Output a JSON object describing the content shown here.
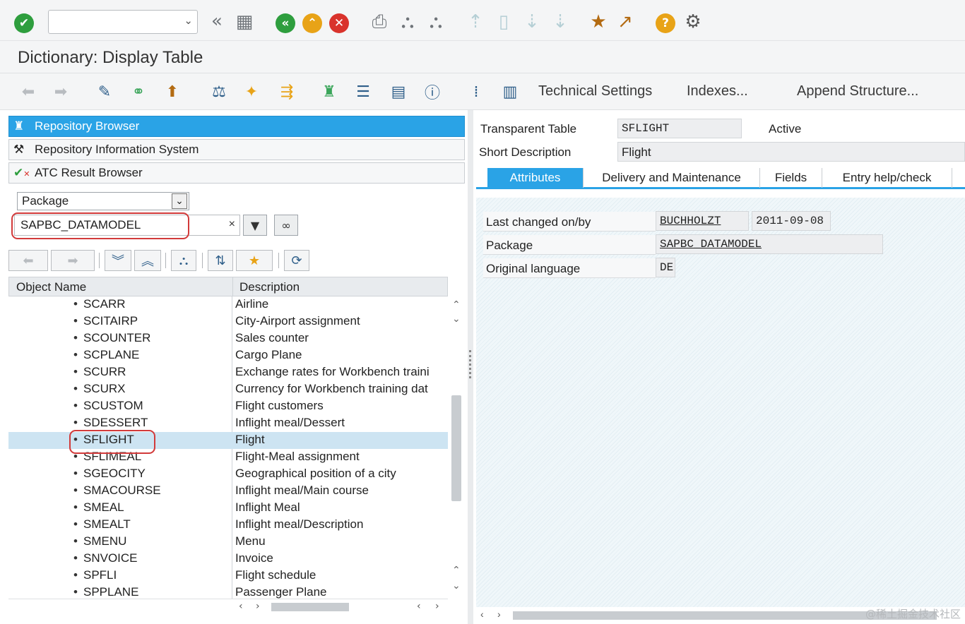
{
  "system_toolbar": {
    "command_field": {
      "value": "",
      "placeholder": ""
    },
    "icons": [
      "enter-check-icon",
      "command-field-dropdown-icon",
      "collapse-left-icon",
      "save-icon",
      "back-icon",
      "exit-icon",
      "cancel-icon",
      "print-icon",
      "find-icon",
      "find-next-icon",
      "first-page-icon",
      "previous-page-icon",
      "next-page-icon",
      "last-page-icon",
      "create-session-icon",
      "shortcut-icon",
      "help-icon",
      "settings-icon"
    ]
  },
  "title": "Dictionary: Display Table",
  "app_toolbar": {
    "technical_settings": "Technical Settings",
    "indexes": "Indexes...",
    "append_structure": "Append Structure..."
  },
  "left_panel": {
    "nav": [
      {
        "label": "Repository Browser",
        "active": true
      },
      {
        "label": "Repository Information System",
        "active": false
      },
      {
        "label": "ATC Result Browser",
        "active": false
      }
    ],
    "object_type": "Package",
    "object_input": "SAPBC_DATAMODEL",
    "tree_header": {
      "name": "Object Name",
      "description": "Description"
    },
    "rows": [
      {
        "name": "SCARR",
        "desc": "Airline"
      },
      {
        "name": "SCITAIRP",
        "desc": "City-Airport assignment"
      },
      {
        "name": "SCOUNTER",
        "desc": "Sales counter"
      },
      {
        "name": "SCPLANE",
        "desc": "Cargo Plane"
      },
      {
        "name": "SCURR",
        "desc": "Exchange rates for Workbench traini"
      },
      {
        "name": "SCURX",
        "desc": "Currency for Workbench training dat"
      },
      {
        "name": "SCUSTOM",
        "desc": "Flight customers"
      },
      {
        "name": "SDESSERT",
        "desc": "Inflight meal/Dessert"
      },
      {
        "name": "SFLIGHT",
        "desc": "Flight",
        "selected": true
      },
      {
        "name": "SFLIMEAL",
        "desc": "Flight-Meal assignment"
      },
      {
        "name": "SGEOCITY",
        "desc": "Geographical position of a city"
      },
      {
        "name": "SMACOURSE",
        "desc": "Inflight meal/Main course"
      },
      {
        "name": "SMEAL",
        "desc": "Inflight Meal"
      },
      {
        "name": "SMEALT",
        "desc": "Inflight meal/Description"
      },
      {
        "name": "SMENU",
        "desc": "Menu"
      },
      {
        "name": "SNVOICE",
        "desc": "Invoice"
      },
      {
        "name": "SPFLI",
        "desc": "Flight schedule"
      },
      {
        "name": "SPPLANE",
        "desc": "Passenger Plane"
      }
    ]
  },
  "right_panel": {
    "table_type_label": "Transparent Table",
    "table_name": "SFLIGHT",
    "status": "Active",
    "short_desc_label": "Short Description",
    "short_desc": "Flight",
    "tabs": [
      "Attributes",
      "Delivery and Maintenance",
      "Fields",
      "Entry help/check"
    ],
    "active_tab": "Attributes",
    "attributes": {
      "last_changed_label": "Last changed on/by",
      "last_changed_by": "BUCHHOLZT",
      "last_changed_on": "2011-09-08",
      "package_label": "Package",
      "package": "SAPBC_DATAMODEL",
      "language_label": "Original language",
      "language": "DE"
    }
  },
  "watermark": "@稀土掘金技术社区",
  "colors": {
    "accent": "#2aa3e6",
    "selection": "#cde4f2",
    "highlight_ring": "#d23a3a"
  }
}
